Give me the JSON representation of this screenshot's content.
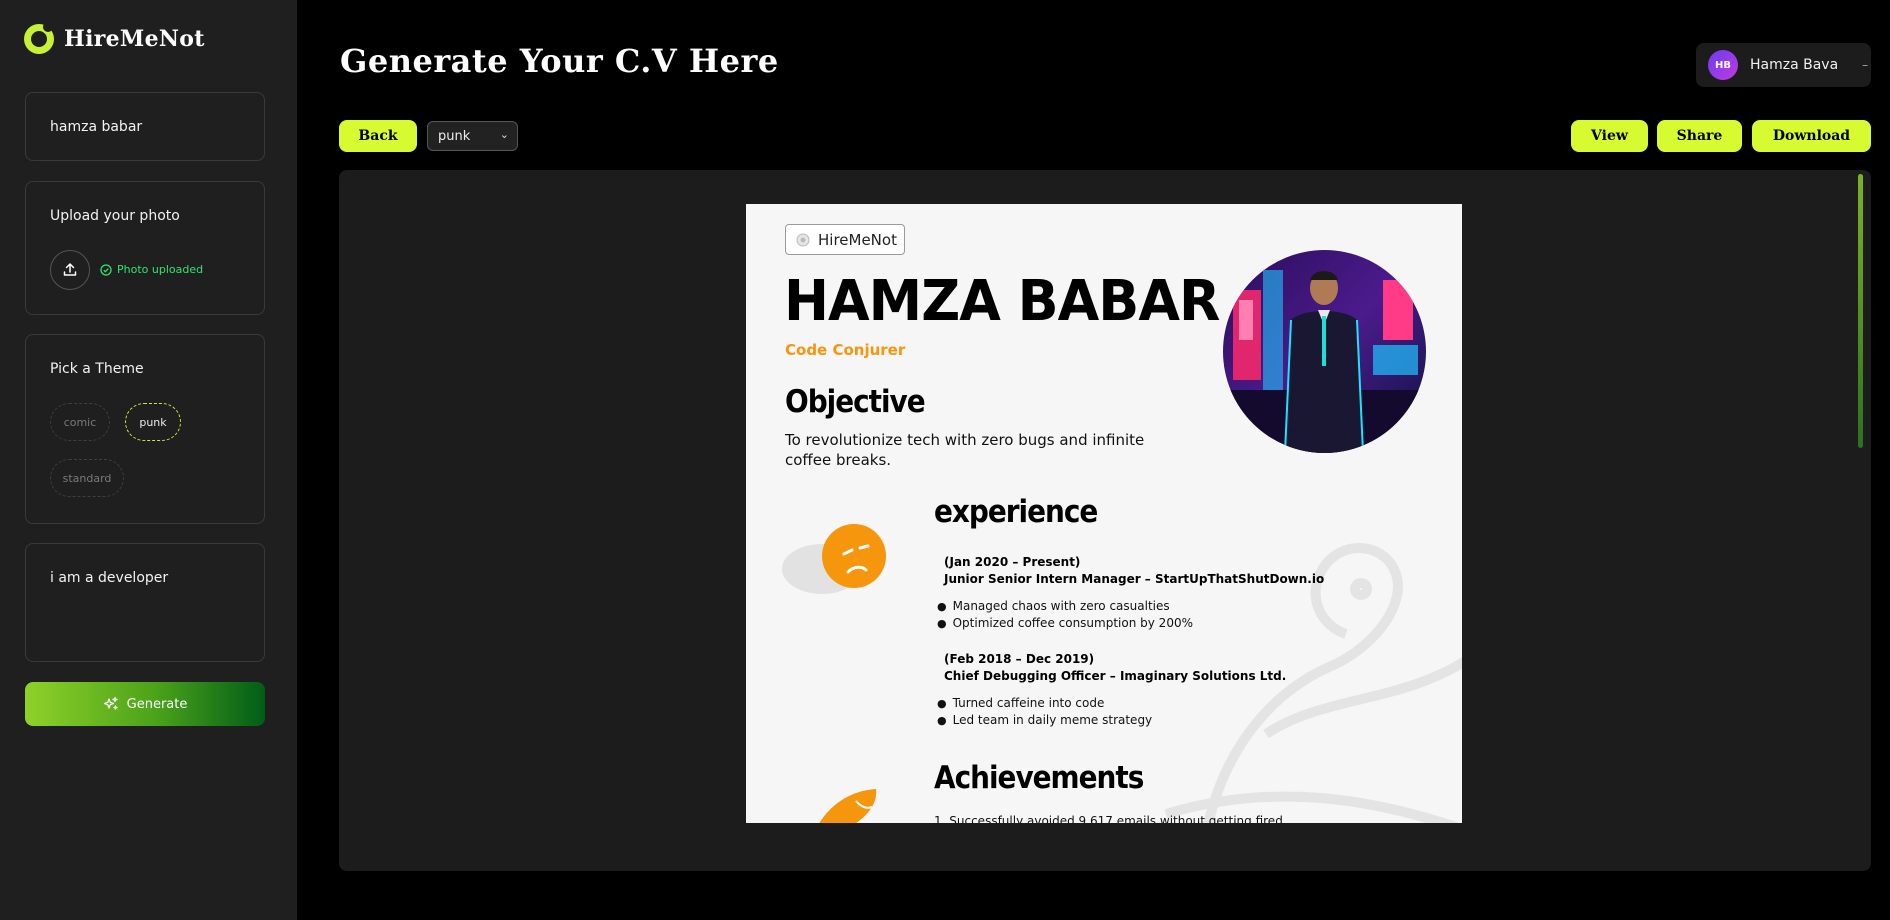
{
  "app": {
    "name": "HireMeNot"
  },
  "sidebar": {
    "name_value": "hamza babar",
    "upload": {
      "title": "Upload your photo",
      "status": "Photo uploaded"
    },
    "theme": {
      "title": "Pick a Theme",
      "options": [
        "comic",
        "punk",
        "standard"
      ],
      "selected": "punk"
    },
    "description_value": "i am a developer",
    "generate_label": "Generate"
  },
  "header": {
    "title": "Generate Your C.V Here",
    "user": {
      "initials": "HB",
      "name": "Hamza Bava"
    }
  },
  "toolbar": {
    "back_label": "Back",
    "theme_select_value": "punk",
    "view_label": "View",
    "share_label": "Share",
    "download_label": "Download"
  },
  "cv": {
    "tag": "HireMeNot",
    "name": "HAMZA BABAR",
    "role": "Code Conjurer",
    "objective_heading": "Objective",
    "objective_text": "To revolutionize tech with zero bugs and infinite coffee breaks.",
    "experience_heading": "experience",
    "experience": [
      {
        "dates": "(Jan 2020 – Present)",
        "title": "Junior Senior Intern Manager – StartUpThatShutDown.io",
        "bullets": [
          "Managed chaos with zero casualties",
          "Optimized coffee consumption by 200%"
        ]
      },
      {
        "dates": "(Feb 2018 – Dec 2019)",
        "title": "Chief Debugging Officer – Imaginary Solutions Ltd.",
        "bullets": [
          "Turned caffeine into code",
          "Led team in daily meme strategy"
        ]
      }
    ],
    "achievements_heading": "Achievements",
    "achievements_first": "1. Successfully avoided 9,617 emails without getting fired"
  },
  "colors": {
    "accent_lime": "#d6fb30",
    "cv_orange": "#f5960c",
    "success_green": "#2ee56b",
    "panel_bg": "#1c1c1c",
    "sidebar_bg": "#1f1f1f"
  }
}
